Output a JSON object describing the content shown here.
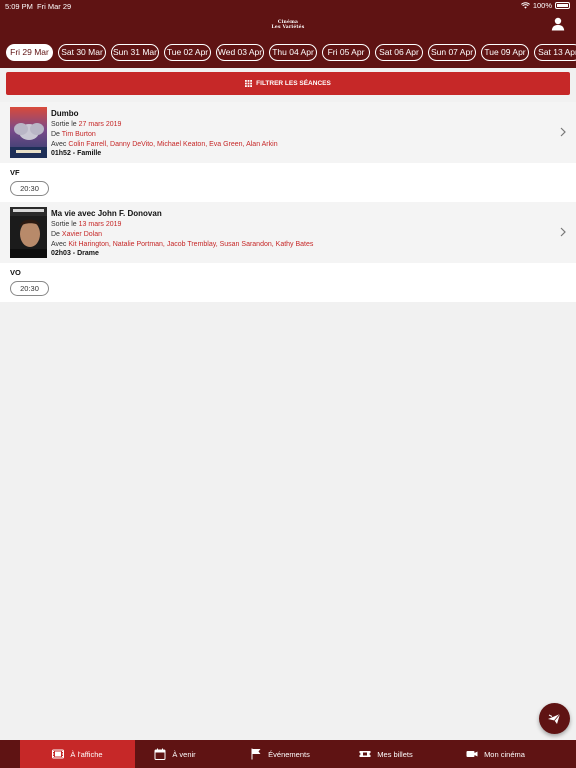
{
  "status": {
    "time": "5:09 PM",
    "date": "Fri Mar 29",
    "battery": "100%"
  },
  "logo": {
    "line1": "Cinéma",
    "line2": "Les Variétés"
  },
  "dates": [
    "Fri 29 Mar",
    "Sat 30 Mar",
    "Sun 31 Mar",
    "Tue 02 Apr",
    "Wed 03 Apr",
    "Thu 04 Apr",
    "Fri 05 Apr",
    "Sat 06 Apr",
    "Sun 07 Apr",
    "Tue 09 Apr",
    "Sat 13 Apr"
  ],
  "filter": {
    "label": "FILTRER LES SÉANCES"
  },
  "movies": [
    {
      "title": "Dumbo",
      "release_prefix": "Sortie le",
      "release_date": "27 mars 2019",
      "director_prefix": "De",
      "director": "Tim Burton",
      "cast_prefix": "Avec",
      "cast": "Colin Farrell,  Danny DeVito,  Michael Keaton,  Eva Green,  Alan Arkin",
      "duration": "01h52 - Famille",
      "version": "VF",
      "showtime": "20:30"
    },
    {
      "title": "Ma vie avec John F. Donovan",
      "release_prefix": "Sortie le",
      "release_date": "13 mars 2019",
      "director_prefix": "De",
      "director": "Xavier Dolan",
      "cast_prefix": "Avec",
      "cast": "Kit Harington,  Natalie Portman,  Jacob Tremblay,  Susan Sarandon,  Kathy Bates",
      "duration": "02h03 - Drame",
      "version": "VO",
      "showtime": "20:30"
    }
  ],
  "tabs": [
    {
      "label": "À l'affiche",
      "icon": "film-icon"
    },
    {
      "label": "À venir",
      "icon": "calendar-icon"
    },
    {
      "label": "Événements",
      "icon": "flag-icon"
    },
    {
      "label": "Mes billets",
      "icon": "ticket-icon"
    },
    {
      "label": "Mon cinéma",
      "icon": "camera-icon"
    }
  ],
  "colors": {
    "header": "#5f1313",
    "accent": "#c62828",
    "background": "#f1f1f1"
  }
}
